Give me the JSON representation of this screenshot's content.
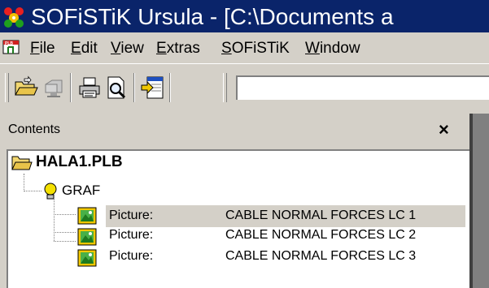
{
  "window": {
    "title": "SOFiSTiK Ursula - [C:\\Documents a"
  },
  "menu": {
    "items": [
      {
        "mnemonic": "F",
        "rest": "ile"
      },
      {
        "mnemonic": "E",
        "rest": "dit"
      },
      {
        "mnemonic": "V",
        "rest": "iew"
      },
      {
        "mnemonic": "E",
        "rest": "xtras"
      },
      {
        "mnemonic": "S",
        "rest": "OFiSTiK"
      },
      {
        "mnemonic": "W",
        "rest": "indow"
      }
    ]
  },
  "toolbar": {
    "icons": [
      "open-folder-icon",
      "network-drive-icon",
      "print-icon",
      "print-preview-icon",
      "import-icon"
    ]
  },
  "panel": {
    "title": "Contents",
    "close": "×"
  },
  "tree": {
    "root": "HALA1.PLB",
    "group": "GRAF",
    "items": [
      {
        "type": "Picture:",
        "name": "CABLE NORMAL FORCES LC 1"
      },
      {
        "type": "Picture:",
        "name": "CABLE NORMAL FORCES LC 2"
      },
      {
        "type": "Picture:",
        "name": "CABLE NORMAL FORCES LC 3"
      }
    ]
  },
  "colors": {
    "titlebar": "#0a246a",
    "face": "#d4d0c8",
    "shadow": "#808080"
  }
}
